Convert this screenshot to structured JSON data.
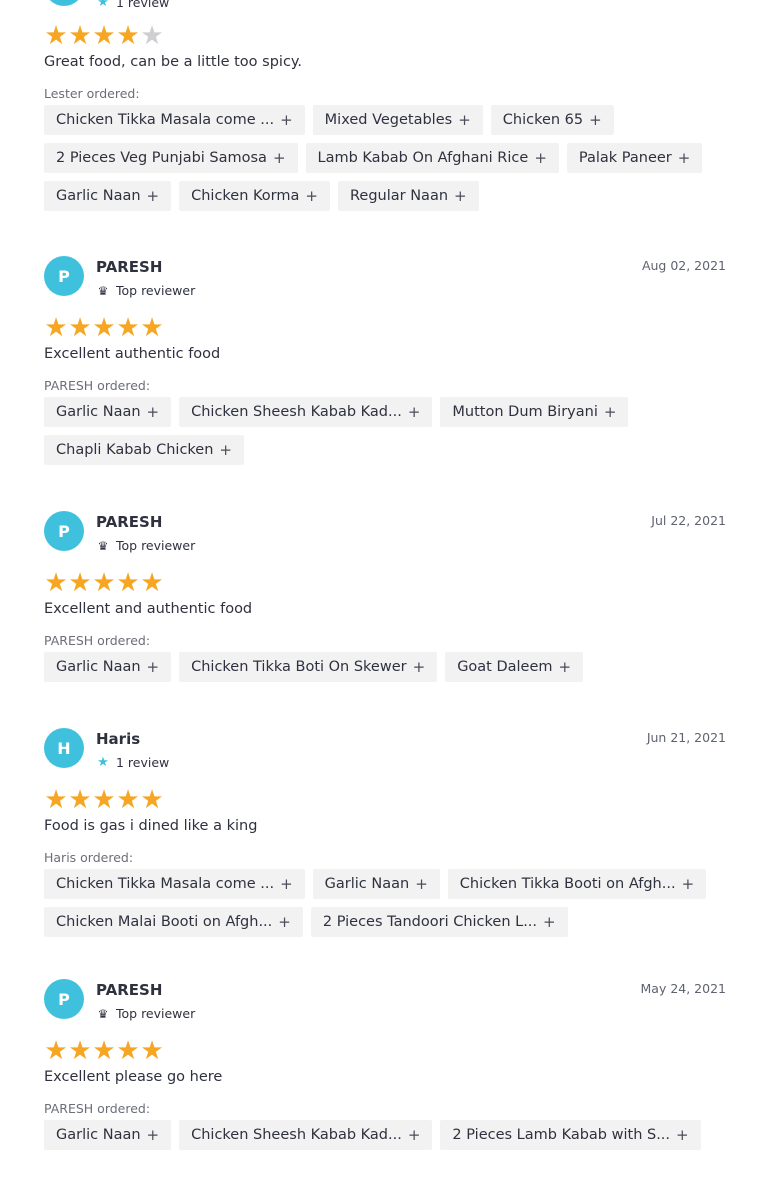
{
  "partial_review": {
    "badge": "1 review",
    "rating": 4,
    "text": "Great food, can be a little too spicy.",
    "ordered_label": "Lester ordered:",
    "items": [
      "Chicken Tikka Masala come ...",
      "Mixed Vegetables",
      "Chicken 65",
      "2 Pieces Veg Punjabi Samosa",
      "Lamb Kabab On Afghani Rice",
      "Palak Paneer",
      "Garlic Naan",
      "Chicken Korma",
      "Regular Naan"
    ]
  },
  "reviews": [
    {
      "initial": "P",
      "name": "PARESH",
      "badge": "Top reviewer",
      "badge_icon": "trophy-icon",
      "date": "Aug 02, 2021",
      "rating": 5,
      "text": "Excellent authentic food",
      "ordered_label": "PARESH ordered:",
      "items": [
        "Garlic Naan",
        "Chicken Sheesh Kabab Kad...",
        "Mutton Dum Biryani",
        "Chapli Kabab Chicken"
      ]
    },
    {
      "initial": "P",
      "name": "PARESH",
      "badge": "Top reviewer",
      "badge_icon": "trophy-icon",
      "date": "Jul 22, 2021",
      "rating": 5,
      "text": "Excellent and authentic food",
      "ordered_label": "PARESH ordered:",
      "items": [
        "Garlic Naan",
        "Chicken Tikka Boti On Skewer",
        "Goat Daleem"
      ]
    },
    {
      "initial": "H",
      "name": "Haris",
      "badge": "1 review",
      "badge_icon": "star-icon",
      "date": "Jun 21, 2021",
      "rating": 5,
      "text": "Food is gas i dined like a king",
      "ordered_label": "Haris ordered:",
      "items": [
        "Chicken Tikka Masala come ...",
        "Garlic Naan",
        "Chicken Tikka Booti on Afgh...",
        "Chicken Malai Booti on Afgh...",
        "2 Pieces Tandoori Chicken L..."
      ]
    },
    {
      "initial": "P",
      "name": "PARESH",
      "badge": "Top reviewer",
      "badge_icon": "trophy-icon",
      "date": "May 24, 2021",
      "rating": 5,
      "text": "Excellent please go here",
      "ordered_label": "PARESH ordered:",
      "items": [
        "Garlic Naan",
        "Chicken Sheesh Kabab Kad...",
        "2 Pieces Lamb Kabab with S..."
      ]
    }
  ],
  "colors": {
    "accent": "#3fc1dd",
    "star_on": "#f6a623",
    "star_off": "#cfcfd2",
    "chip_bg": "#f2f2f2"
  }
}
